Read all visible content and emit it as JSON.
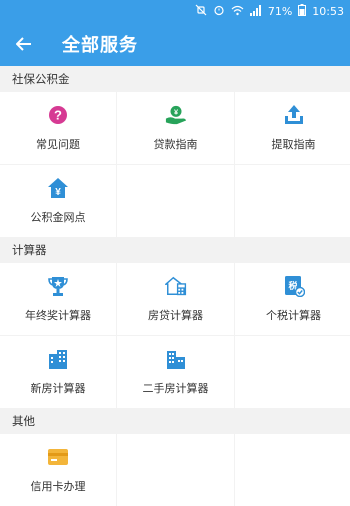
{
  "status": {
    "battery": "71%",
    "time": "10:53"
  },
  "appbar": {
    "title": "全部服务"
  },
  "sections": [
    {
      "title": "社保公积金",
      "items": [
        "常见问题",
        "贷款指南",
        "提取指南",
        "公积金网点"
      ]
    },
    {
      "title": "计算器",
      "items": [
        "年终奖计算器",
        "房贷计算器",
        "个税计算器",
        "新房计算器",
        "二手房计算器"
      ]
    },
    {
      "title": "其他",
      "items": [
        "信用卡办理"
      ]
    }
  ],
  "colors": {
    "primary": "#3a9ee8",
    "faq": "#d63a93",
    "loan": "#27a35a",
    "blue_icon": "#2f8fd6",
    "card": "#f3b53a"
  },
  "icons": [
    "question-icon",
    "loan-hand-icon",
    "upload-tray-icon",
    "home-yen-icon",
    "trophy-icon",
    "house-calculator-icon",
    "tax-calculator-icon",
    "building-calculator-icon",
    "second-house-icon",
    "credit-card-icon"
  ]
}
